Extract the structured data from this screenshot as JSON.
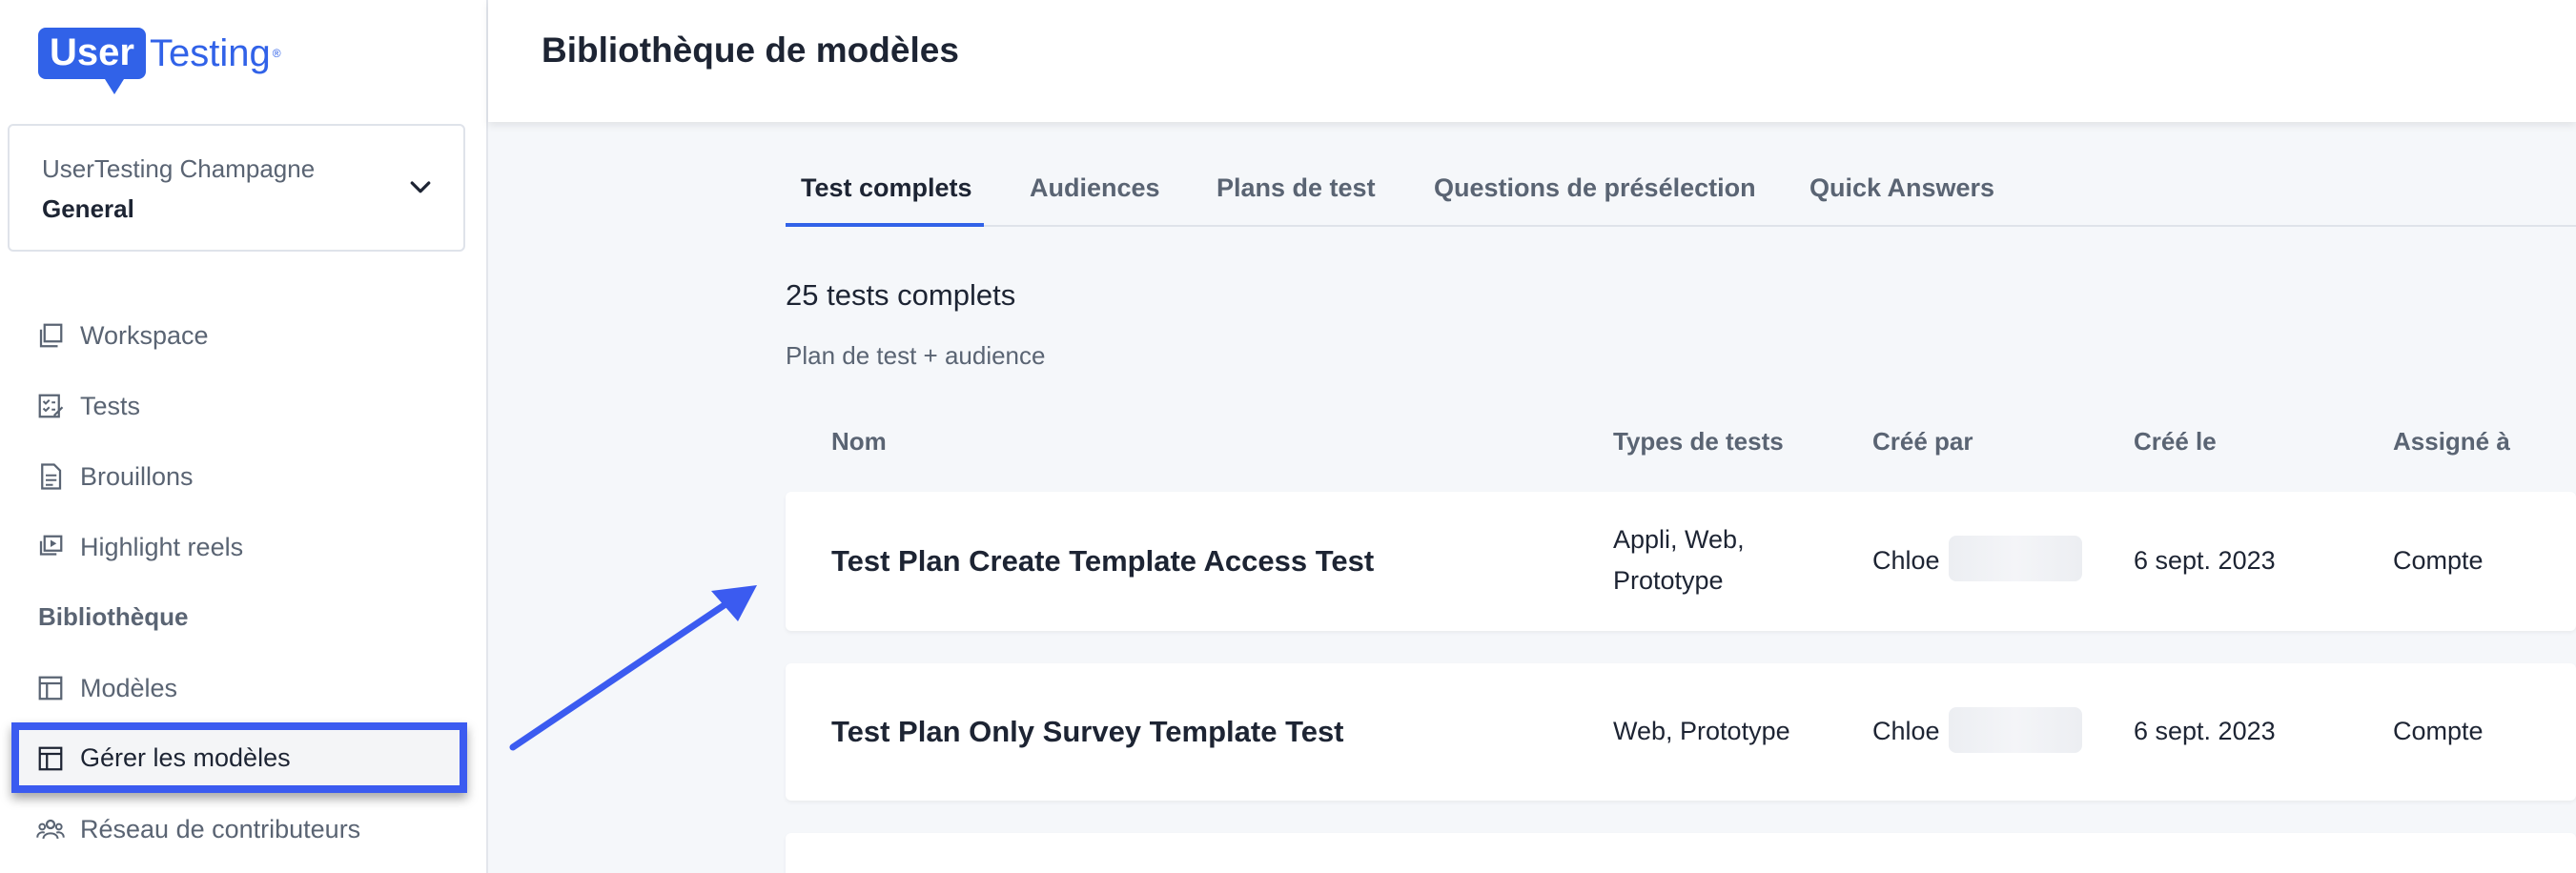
{
  "brand": {
    "user": "User",
    "testing": "Testing",
    "reg": "®",
    "primary_color": "#3162e8"
  },
  "account": {
    "organization": "UserTesting Champagne",
    "workspace": "General"
  },
  "sidebar": {
    "items": [
      {
        "label": "Workspace",
        "icon": "workspace-icon"
      },
      {
        "label": "Tests",
        "icon": "tests-icon"
      },
      {
        "label": "Brouillons",
        "icon": "drafts-icon"
      },
      {
        "label": "Highlight reels",
        "icon": "highlight-reels-icon"
      }
    ],
    "section_library": "Bibliothèque",
    "library_items": [
      {
        "label": "Modèles",
        "icon": "templates-icon"
      },
      {
        "label": "Gérer les modèles",
        "icon": "manage-templates-icon"
      },
      {
        "label": "Réseau de contributeurs",
        "icon": "contributors-icon"
      }
    ],
    "highlight_color": "#3b5bf0"
  },
  "header": {
    "title": "Bibliothèque de modèles"
  },
  "tabs": [
    "Test complets",
    "Audiences",
    "Plans de test",
    "Questions de présélection",
    "Quick Answers"
  ],
  "main": {
    "count": "25 tests complets",
    "subtitle": "Plan de test + audience",
    "columns": [
      "Nom",
      "Types de tests",
      "Créé par",
      "Créé le",
      "Assigné à"
    ],
    "rows": [
      {
        "name": "Test Plan Create Template Access Test",
        "types_line1": "Appli, Web,",
        "types_line2": "Prototype",
        "author": "Chloe",
        "created": "6 sept. 2023",
        "assigned": "Compte"
      },
      {
        "name": "Test Plan Only Survey Template Test",
        "types_line1": "Web, Prototype",
        "author": "Chloe",
        "created": "6 sept. 2023",
        "assigned": "Compte"
      }
    ]
  }
}
